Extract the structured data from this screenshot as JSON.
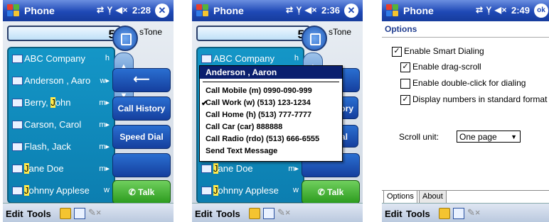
{
  "screen1": {
    "title": "Phone",
    "status_icons": "⇄ Ỵ ◀×",
    "time": "2:28",
    "close": "✕",
    "number": "5",
    "tone_label": "sTone",
    "contacts": [
      {
        "name": "ABC Company",
        "type": "h"
      },
      {
        "name": "Anderson , Aaro",
        "type": "w▸"
      },
      {
        "name_pre": "Berry, ",
        "name_hl": "J",
        "name_post": "ohn",
        "type": "m▸"
      },
      {
        "name_pre": "Car",
        "name_hl": "",
        "name_post": "son, Carol",
        "type": "m▸"
      },
      {
        "name": "Flash, Jack",
        "type": "m▸"
      },
      {
        "name_pre": "",
        "name_hl": "J",
        "name_post": "ane Doe",
        "type": "m▸"
      },
      {
        "name_pre": "",
        "name_hl": "J",
        "name_post": "ohnny Applese",
        "type": "w"
      }
    ],
    "buttons": {
      "call_history": "Call History",
      "speed_dial": "Speed Dial",
      "talk": "Talk",
      "back": "⟵"
    }
  },
  "screen2": {
    "title": "Phone",
    "time": "2:36",
    "number": "5",
    "tone_label": "sTone",
    "popup": {
      "header": "Anderson , Aaron",
      "items": [
        "Call Mobile (m) 0990-090-999",
        "Call Work (w) (513) 123-1234",
        "Call Home (h) (513) 777-7777",
        "Call Car (car) 888888",
        "Call Radio (rdo) (513) 666-6555",
        "Send Text Message"
      ],
      "checked_index": 1
    },
    "partial_buttons": {
      "history": "ory",
      "dial": "ial"
    }
  },
  "screen3": {
    "title": "Phone",
    "time": "2:49",
    "ok": "ok",
    "header": "Options",
    "options": [
      {
        "label": "Enable Smart Dialing",
        "checked": true
      },
      {
        "label": "Enable drag-scroll",
        "checked": true
      },
      {
        "label": "Enable double-click for dialing",
        "checked": false
      },
      {
        "label": "Display numbers in standard format",
        "checked": true
      }
    ],
    "scroll_unit_label": "Scroll unit:",
    "scroll_unit_value": "One page",
    "tabs": [
      "Options",
      "About"
    ]
  },
  "menubar": {
    "edit": "Edit",
    "tools": "Tools"
  },
  "colors": {
    "title_bar": "#1f49b6",
    "list_bg": "#1496c7",
    "button_blue": "#153f9e",
    "talk_green": "#2b9a1d",
    "highlight": "#ffe84a"
  }
}
